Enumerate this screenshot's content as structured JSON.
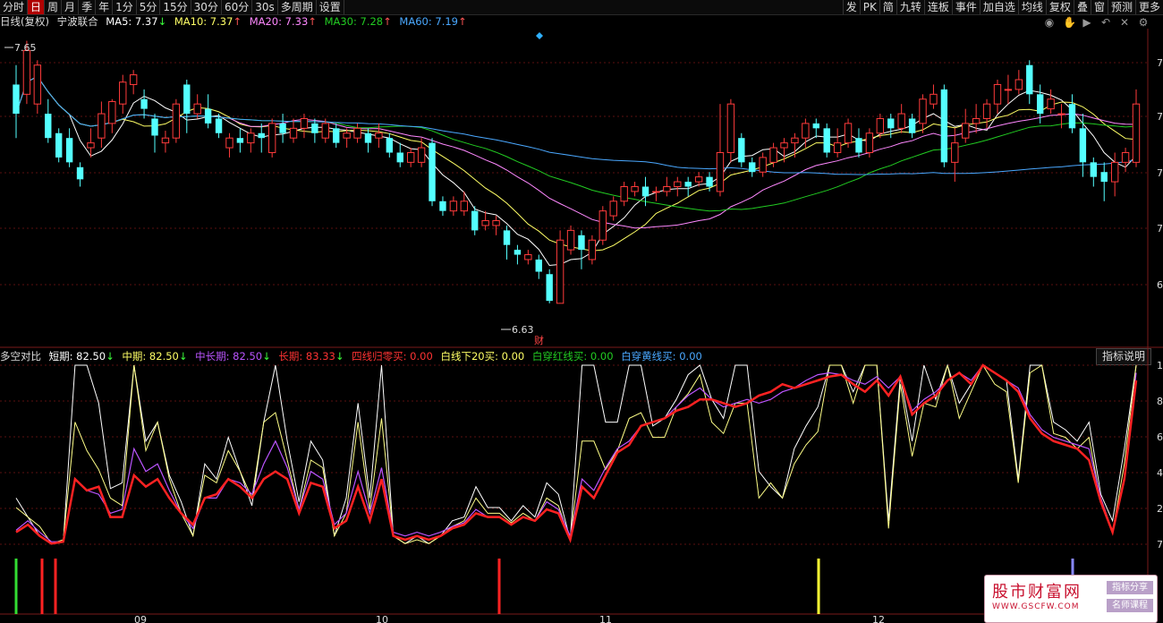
{
  "toolbar": {
    "periods": [
      "分时",
      "日",
      "周",
      "月",
      "季",
      "年",
      "1分",
      "5分",
      "15分",
      "30分",
      "60分",
      "30s",
      "多周期",
      "设置"
    ],
    "active_period": "日",
    "right_buttons": [
      "发",
      "PK",
      "简",
      "九转",
      "连板",
      "事件",
      "加自选",
      "均线",
      "复权",
      "叠",
      "窗",
      "预测",
      "更多"
    ]
  },
  "main_legend": {
    "prefix": "日线(复权)",
    "stock_name": "宁波联合",
    "ma5": "MA5: 7.37",
    "ma10": "MA10: 7.37",
    "ma20": "MA20: 7.33",
    "ma30": "MA30: 7.28",
    "ma60": "MA60: 7.19",
    "arrow_down": "↓",
    "arrow_up": "↑"
  },
  "price_labels": {
    "high": "7.65",
    "low": "6.63",
    "event_badge": "财"
  },
  "right_axis_top": [
    "7",
    "7",
    "7",
    "7",
    "6"
  ],
  "right_axis_bottom": [
    "1",
    "8",
    "6",
    "4",
    "2",
    "7"
  ],
  "x_axis_labels": [
    "09",
    "10",
    "11",
    "12"
  ],
  "indicator_legend": {
    "name": "多空对比",
    "short": "短期: 82.50",
    "mid": "中期: 82.50",
    "midlong": "中长期: 82.50",
    "long": "长期: 83.33",
    "s1": "四线归零买: 0.00",
    "s2": "白线下20买: 0.00",
    "s3": "白穿红线买: 0.00",
    "s4": "白穿黄线买: 0.00"
  },
  "indicator_button": "指标说明",
  "toolbar_icons": [
    "eye-icon",
    "hand-icon",
    "play-icon",
    "undo-icon",
    "cross-icon",
    "settings-icon"
  ],
  "watermark": {
    "title": "股市财富网",
    "url": "WWW.GSCFW.COM",
    "tag1": "指标分享",
    "tag2": "名师课程"
  },
  "colors": {
    "up": "#ff3b3b",
    "down": "#54ffff",
    "ma5": "#ffffff",
    "ma10": "#ffff66",
    "ma20": "#ff88ff",
    "ma30": "#22cc22",
    "ma60": "#4aa8ff",
    "line_white": "#ffffff",
    "line_yellow": "#ffff88",
    "line_purple": "#bb55ff",
    "line_red": "#ff2222"
  },
  "chart_data": [
    {
      "type": "candlestick",
      "title": "宁波联合 日线(复权)",
      "ylim": [
        6.45,
        7.75
      ],
      "candles": [
        [
          7.52,
          7.4,
          7.3,
          7.6
        ],
        [
          7.48,
          7.66,
          7.44,
          7.7
        ],
        [
          7.44,
          7.6,
          7.4,
          7.62
        ],
        [
          7.4,
          7.3,
          7.28,
          7.46
        ],
        [
          7.32,
          7.22,
          7.2,
          7.34
        ],
        [
          7.3,
          7.2,
          7.18,
          7.34
        ],
        [
          7.18,
          7.13,
          7.1,
          7.2
        ],
        [
          7.26,
          7.28,
          7.22,
          7.34
        ],
        [
          7.3,
          7.4,
          7.26,
          7.45
        ],
        [
          7.36,
          7.45,
          7.32,
          7.46
        ],
        [
          7.44,
          7.53,
          7.4,
          7.56
        ],
        [
          7.52,
          7.56,
          7.48,
          7.58
        ],
        [
          7.46,
          7.42,
          7.38,
          7.5
        ],
        [
          7.38,
          7.31,
          7.24,
          7.4
        ],
        [
          7.28,
          7.3,
          7.24,
          7.33
        ],
        [
          7.3,
          7.44,
          7.28,
          7.46
        ],
        [
          7.52,
          7.4,
          7.32,
          7.54
        ],
        [
          7.4,
          7.44,
          7.38,
          7.48
        ],
        [
          7.42,
          7.36,
          7.34,
          7.48
        ],
        [
          7.38,
          7.32,
          7.3,
          7.4
        ],
        [
          7.26,
          7.3,
          7.22,
          7.32
        ],
        [
          7.3,
          7.28,
          7.24,
          7.34
        ],
        [
          7.28,
          7.32,
          7.24,
          7.34
        ],
        [
          7.32,
          7.3,
          7.24,
          7.36
        ],
        [
          7.24,
          7.36,
          7.22,
          7.38
        ],
        [
          7.36,
          7.32,
          7.28,
          7.4
        ],
        [
          7.3,
          7.34,
          7.28,
          7.38
        ],
        [
          7.34,
          7.38,
          7.3,
          7.4
        ],
        [
          7.36,
          7.32,
          7.28,
          7.38
        ],
        [
          7.3,
          7.36,
          7.28,
          7.38
        ],
        [
          7.34,
          7.28,
          7.26,
          7.36
        ],
        [
          7.3,
          7.32,
          7.26,
          7.34
        ],
        [
          7.3,
          7.34,
          7.28,
          7.36
        ],
        [
          7.32,
          7.28,
          7.24,
          7.34
        ],
        [
          7.3,
          7.32,
          7.26,
          7.36
        ],
        [
          7.3,
          7.24,
          7.22,
          7.32
        ],
        [
          7.24,
          7.2,
          7.18,
          7.28
        ],
        [
          7.2,
          7.24,
          7.18,
          7.26
        ],
        [
          7.2,
          7.26,
          7.18,
          7.3
        ],
        [
          7.28,
          7.04,
          7.02,
          7.3
        ],
        [
          7.04,
          7.0,
          6.98,
          7.06
        ],
        [
          7.0,
          7.04,
          6.98,
          7.06
        ],
        [
          7.0,
          7.04,
          6.98,
          7.08
        ],
        [
          7.0,
          6.92,
          6.9,
          7.02
        ],
        [
          6.94,
          6.96,
          6.92,
          7.0
        ],
        [
          6.94,
          6.96,
          6.9,
          6.98
        ],
        [
          6.92,
          6.86,
          6.8,
          6.94
        ],
        [
          6.84,
          6.82,
          6.78,
          6.86
        ],
        [
          6.8,
          6.82,
          6.78,
          6.84
        ],
        [
          6.8,
          6.75,
          6.72,
          6.82
        ],
        [
          6.74,
          6.63,
          6.62,
          6.76
        ],
        [
          6.62,
          6.88,
          6.62,
          6.92
        ],
        [
          6.84,
          6.92,
          6.82,
          6.94
        ],
        [
          6.9,
          6.84,
          6.76,
          6.92
        ],
        [
          6.8,
          6.88,
          6.78,
          6.9
        ],
        [
          6.88,
          7.0,
          6.86,
          7.02
        ],
        [
          6.98,
          7.04,
          6.96,
          7.06
        ],
        [
          7.04,
          7.1,
          7.02,
          7.12
        ],
        [
          7.08,
          7.1,
          7.06,
          7.12
        ],
        [
          7.1,
          7.06,
          7.02,
          7.14
        ],
        [
          7.08,
          7.08,
          7.04,
          7.1
        ],
        [
          7.08,
          7.1,
          7.06,
          7.14
        ],
        [
          7.1,
          7.12,
          7.06,
          7.14
        ],
        [
          7.12,
          7.1,
          7.06,
          7.14
        ],
        [
          7.12,
          7.14,
          7.1,
          7.16
        ],
        [
          7.14,
          7.1,
          7.08,
          7.16
        ],
        [
          7.08,
          7.24,
          7.06,
          7.44
        ],
        [
          7.24,
          7.44,
          7.2,
          7.46
        ],
        [
          7.3,
          7.2,
          7.18,
          7.32
        ],
        [
          7.2,
          7.16,
          7.14,
          7.22
        ],
        [
          7.16,
          7.22,
          7.14,
          7.24
        ],
        [
          7.2,
          7.26,
          7.18,
          7.28
        ],
        [
          7.26,
          7.28,
          7.2,
          7.3
        ],
        [
          7.28,
          7.3,
          7.22,
          7.32
        ],
        [
          7.3,
          7.36,
          7.26,
          7.38
        ],
        [
          7.36,
          7.34,
          7.3,
          7.38
        ],
        [
          7.34,
          7.24,
          7.22,
          7.36
        ],
        [
          7.24,
          7.28,
          7.22,
          7.34
        ],
        [
          7.28,
          7.36,
          7.26,
          7.38
        ],
        [
          7.3,
          7.24,
          7.22,
          7.34
        ],
        [
          7.24,
          7.32,
          7.22,
          7.34
        ],
        [
          7.32,
          7.38,
          7.3,
          7.4
        ],
        [
          7.38,
          7.34,
          7.3,
          7.4
        ],
        [
          7.34,
          7.4,
          7.32,
          7.44
        ],
        [
          7.38,
          7.32,
          7.3,
          7.4
        ],
        [
          7.36,
          7.46,
          7.32,
          7.48
        ],
        [
          7.44,
          7.48,
          7.42,
          7.52
        ],
        [
          7.5,
          7.2,
          7.18,
          7.52
        ],
        [
          7.2,
          7.28,
          7.12,
          7.34
        ],
        [
          7.3,
          7.36,
          7.28,
          7.42
        ],
        [
          7.36,
          7.38,
          7.32,
          7.44
        ],
        [
          7.38,
          7.44,
          7.34,
          7.46
        ],
        [
          7.44,
          7.52,
          7.4,
          7.54
        ],
        [
          7.5,
          7.5,
          7.44,
          7.56
        ],
        [
          7.5,
          7.54,
          7.48,
          7.58
        ],
        [
          7.6,
          7.48,
          7.44,
          7.62
        ],
        [
          7.48,
          7.4,
          7.36,
          7.52
        ],
        [
          7.42,
          7.46,
          7.4,
          7.5
        ],
        [
          7.4,
          7.4,
          7.34,
          7.44
        ],
        [
          7.44,
          7.34,
          7.32,
          7.48
        ],
        [
          7.34,
          7.2,
          7.14,
          7.4
        ],
        [
          7.2,
          7.14,
          7.1,
          7.22
        ],
        [
          7.16,
          7.12,
          7.04,
          7.2
        ],
        [
          7.12,
          7.2,
          7.06,
          7.24
        ],
        [
          7.2,
          7.24,
          7.16,
          7.26
        ],
        [
          7.2,
          7.44,
          7.18,
          7.5
        ]
      ]
    },
    {
      "type": "line",
      "title": "多空对比",
      "ylim": [
        0,
        100
      ],
      "series": [
        {
          "name": "短期",
          "values": [
            30,
            20,
            10,
            6,
            7,
            100,
            100,
            80,
            35,
            38,
            100,
            60,
            70,
            42,
            28,
            10,
            48,
            40,
            62,
            44,
            26,
            70,
            100,
            60,
            28,
            60,
            50,
            10,
            30,
            80,
            30,
            100,
            10,
            6,
            10,
            6,
            10,
            18,
            20,
            36,
            25,
            25,
            18,
            26,
            20,
            38,
            32,
            8,
            100,
            100,
            70,
            70,
            100,
            100,
            68,
            72,
            82,
            95,
            100,
            82,
            72,
            100,
            100,
            44,
            36,
            30,
            56,
            68,
            78,
            100,
            100,
            86,
            100,
            100,
            18,
            94,
            60,
            100,
            82,
            100,
            80,
            90,
            100,
            96,
            92,
            40,
            100,
            100,
            70,
            66,
            60,
            70,
            32,
            18,
            56,
            100
          ]
        },
        {
          "name": "中期",
          "values": [
            25,
            20,
            15,
            6,
            8,
            70,
            55,
            45,
            30,
            26,
            100,
            55,
            70,
            40,
            22,
            10,
            42,
            38,
            55,
            44,
            30,
            70,
            75,
            50,
            24,
            50,
            46,
            10,
            22,
            70,
            24,
            72,
            10,
            6,
            8,
            6,
            10,
            15,
            18,
            30,
            22,
            22,
            17,
            22,
            18,
            30,
            26,
            8,
            60,
            60,
            45,
            55,
            72,
            75,
            62,
            62,
            78,
            85,
            95,
            70,
            64,
            80,
            80,
            30,
            38,
            30,
            48,
            58,
            65,
            100,
            100,
            80,
            100,
            100,
            14,
            90,
            52,
            80,
            78,
            100,
            72,
            86,
            100,
            90,
            86,
            38,
            96,
            100,
            64,
            62,
            56,
            62,
            28,
            12,
            48,
            100
          ]
        },
        {
          "name": "中长期",
          "values": [
            13,
            18,
            12,
            7,
            7,
            40,
            34,
            32,
            22,
            24,
            56,
            44,
            48,
            34,
            22,
            14,
            30,
            30,
            40,
            38,
            32,
            48,
            60,
            46,
            24,
            44,
            40,
            16,
            22,
            44,
            22,
            46,
            12,
            10,
            12,
            10,
            12,
            15,
            17,
            24,
            20,
            20,
            16,
            20,
            18,
            28,
            24,
            10,
            40,
            34,
            46,
            56,
            60,
            68,
            70,
            72,
            78,
            84,
            88,
            82,
            78,
            80,
            82,
            80,
            82,
            86,
            88,
            92,
            95,
            96,
            95,
            92,
            90,
            94,
            88,
            94,
            76,
            82,
            86,
            92,
            96,
            92,
            100,
            96,
            92,
            88,
            74,
            66,
            62,
            60,
            58,
            56,
            30,
            12,
            40,
            96
          ]
        },
        {
          "name": "长期",
          "values": [
            12,
            16,
            10,
            6,
            7,
            40,
            34,
            36,
            20,
            20,
            42,
            36,
            40,
            30,
            22,
            16,
            30,
            32,
            40,
            36,
            30,
            40,
            44,
            40,
            22,
            38,
            36,
            14,
            18,
            36,
            18,
            40,
            10,
            8,
            10,
            8,
            10,
            14,
            16,
            22,
            20,
            20,
            16,
            20,
            18,
            24,
            22,
            8,
            36,
            30,
            42,
            54,
            58,
            68,
            70,
            72,
            76,
            78,
            82,
            82,
            80,
            78,
            80,
            84,
            86,
            90,
            88,
            90,
            92,
            94,
            95,
            90,
            86,
            92,
            84,
            94,
            74,
            80,
            84,
            92,
            96,
            90,
            100,
            96,
            92,
            86,
            72,
            64,
            60,
            58,
            56,
            50,
            28,
            12,
            40,
            92
          ]
        }
      ],
      "buy_signals": [
        {
          "name": "四线归零买",
          "count": 3
        },
        {
          "name": "白线下20买",
          "count": 1
        },
        {
          "name": "白穿红线买",
          "count": 0
        },
        {
          "name": "白穿黄线买",
          "count": 1
        }
      ]
    }
  ]
}
